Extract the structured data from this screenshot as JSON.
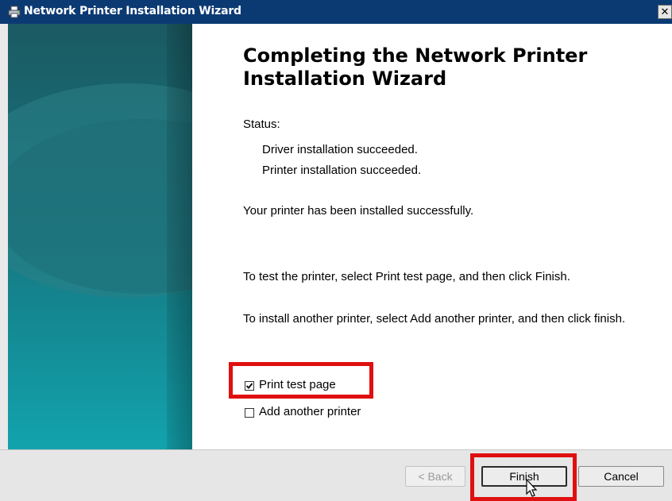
{
  "window": {
    "title": "Network Printer Installation Wizard",
    "close_glyph": "✕",
    "app_icon": "printer-icon"
  },
  "content": {
    "heading": "Completing the Network Printer Installation Wizard",
    "status_label": "Status:",
    "status_lines": [
      "Driver installation succeeded.",
      "Printer installation succeeded."
    ],
    "success_message": "Your printer has been installed successfully.",
    "test_instruction": "To test the printer, select Print test page, and then click Finish.",
    "install_instruction": "To install another printer, select Add another printer, and then click finish."
  },
  "options": [
    {
      "label": "Print test page",
      "checked": true
    },
    {
      "label": "Add another printer",
      "checked": false
    }
  ],
  "buttons": {
    "back": "< Back",
    "finish": "Finish",
    "cancel": "Cancel"
  },
  "colors": {
    "titlebar": "#0b3a73",
    "highlight": "#e01010",
    "sidebar_teal": "#138f9c"
  }
}
